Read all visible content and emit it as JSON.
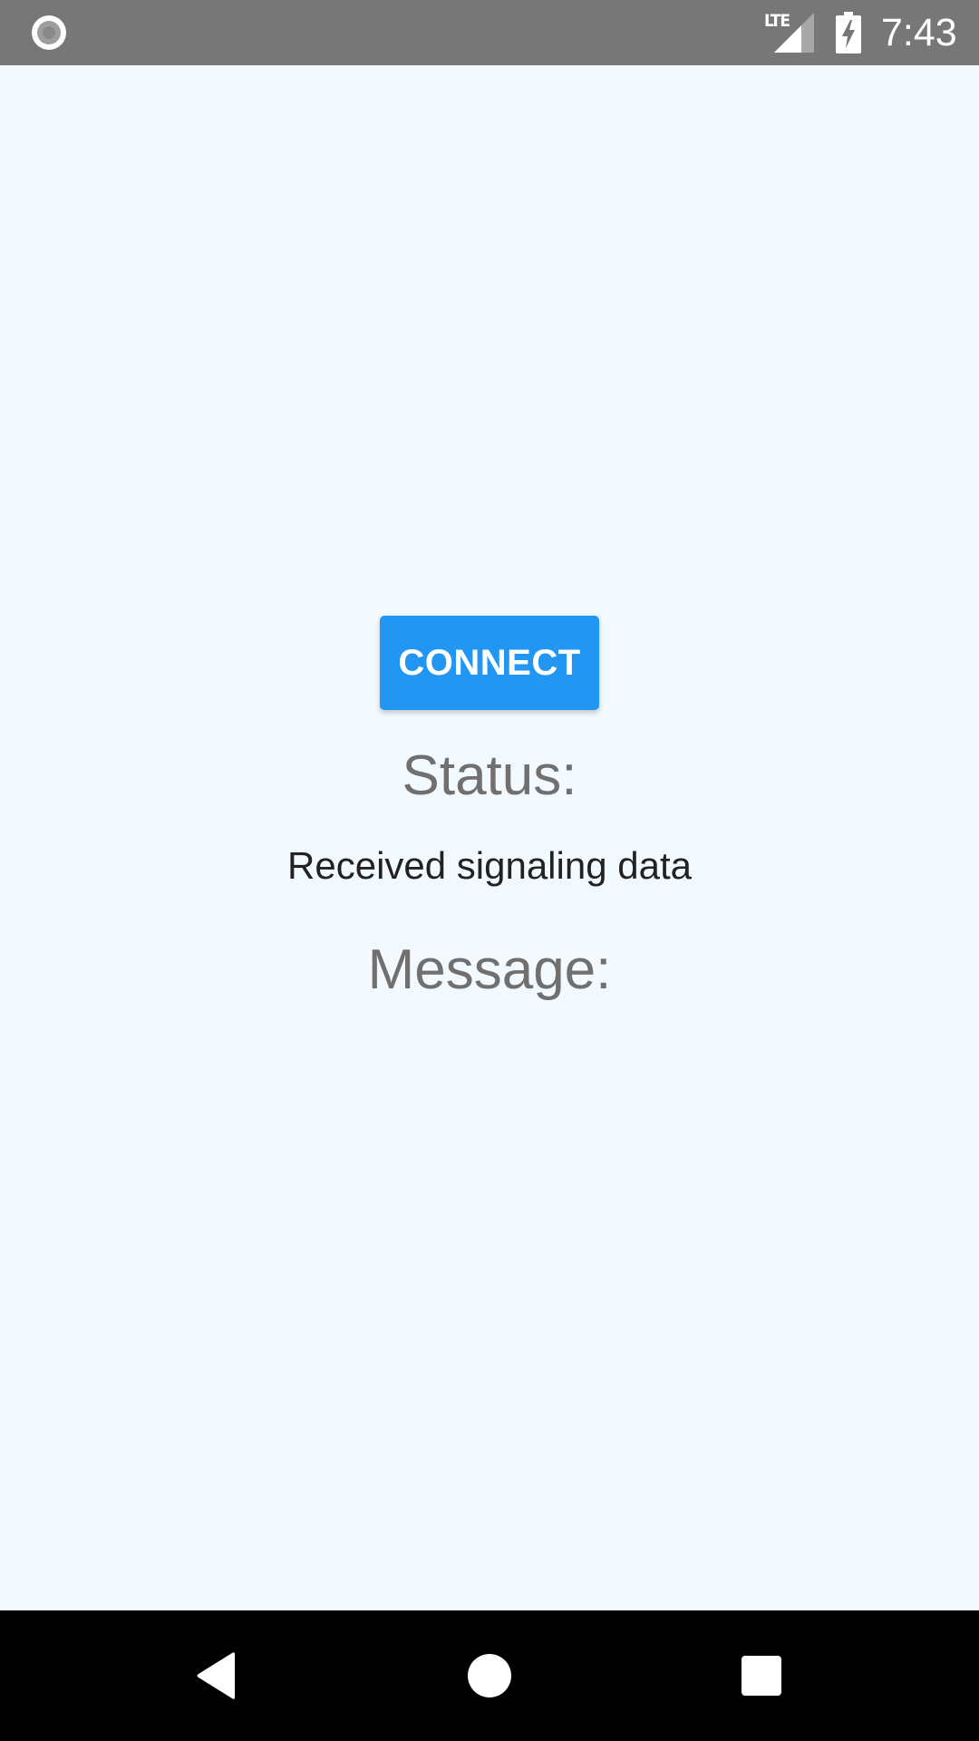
{
  "status_bar": {
    "network_label": "LTE",
    "time": "7:43",
    "icons": [
      "notification-circle-icon",
      "signal-icon",
      "battery-charging-icon"
    ]
  },
  "main": {
    "connect_button_label": "CONNECT",
    "status_label": "Status:",
    "status_value": "Received signaling data",
    "message_label": "Message:",
    "message_value": ""
  },
  "nav_bar": {
    "buttons": [
      "back-icon",
      "home-icon",
      "recents-icon"
    ]
  },
  "colors": {
    "background": "#F3FAFF",
    "accent": "#2196F3",
    "status_bar": "#777777",
    "nav_bar": "#000000",
    "label_text": "#707070",
    "value_text": "#222222"
  }
}
